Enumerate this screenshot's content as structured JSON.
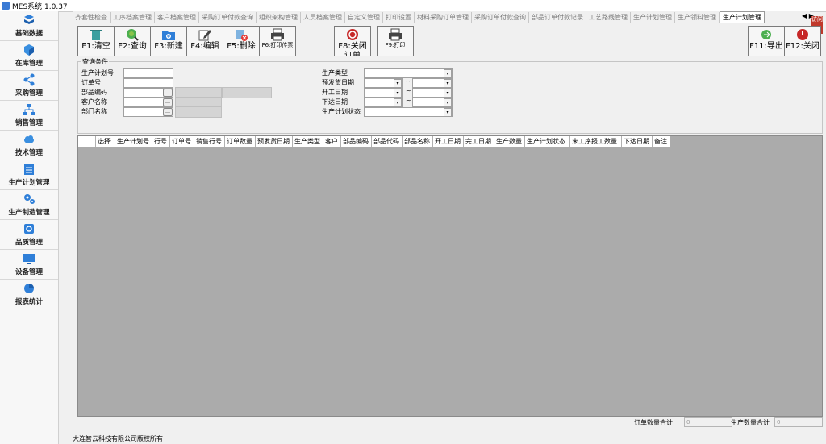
{
  "window": {
    "title": "MES系统 1.0.37"
  },
  "sidebar": {
    "items": [
      {
        "label": "基础数据",
        "icon": "cube-stack-icon"
      },
      {
        "label": "在库管理",
        "icon": "cube-icon"
      },
      {
        "label": "采购管理",
        "icon": "share-icon"
      },
      {
        "label": "销售管理",
        "icon": "org-chart-icon"
      },
      {
        "label": "技术管理",
        "icon": "cloud-icon"
      },
      {
        "label": "生产计划管理",
        "icon": "calendar-list-icon"
      },
      {
        "label": "生产制造管理",
        "icon": "gears-icon"
      },
      {
        "label": "品质管理",
        "icon": "quality-icon"
      },
      {
        "label": "设备管理",
        "icon": "monitor-icon"
      },
      {
        "label": "报表统计",
        "icon": "pie-chart-icon"
      }
    ]
  },
  "tabs": [
    "齐套性检查",
    "工序档案管理",
    "客户档案管理",
    "采购订单付款查询",
    "组织架构管理",
    "人员档案管理",
    "自定义管理",
    "打印设置",
    "材料采购订单管理",
    "采购订单付款查询",
    "部品订单付款记录",
    "工艺路线管理",
    "生产计划管理",
    "生产领料管理",
    "生产计划管理"
  ],
  "tab_nav": "◀ ▶",
  "badge": "访问",
  "toolbar": {
    "clear": "F1:清空",
    "query": "F2:查询",
    "new": "F3:新建",
    "edit": "F4:编辑",
    "delete": "F5:删除",
    "print_ticket": "F6:打印传票",
    "close_order": "F8:关闭订单",
    "print": "F9:打印",
    "export": "F11:导出",
    "close": "F12:关闭"
  },
  "query": {
    "legend": "查询条件",
    "plan_no": "生产计划号",
    "order_no": "订单号",
    "part_code": "部品编码",
    "customer": "客户名称",
    "dept": "部门名称",
    "prod_type": "生产类型",
    "ship_date": "预发货日期",
    "start_date": "开工日期",
    "issue_date": "下达日期",
    "plan_status": "生产计划状态",
    "tilde": "~"
  },
  "grid": {
    "columns": [
      "选择",
      "生产计划号",
      "行号",
      "订单号",
      "销售行号",
      "订单数量",
      "预发货日期",
      "生产类型",
      "客户",
      "部品编码",
      "部品代码",
      "部品名称",
      "开工日期",
      "完工日期",
      "生产数量",
      "生产计划状态",
      "末工序报工数量",
      "下达日期",
      "备注"
    ]
  },
  "summary": {
    "order_qty_label": "订单数量合计",
    "order_qty_value": "0",
    "prod_qty_label": "生产数量合计",
    "prod_qty_value": "0"
  },
  "status": {
    "copyright": "大连智云科技有限公司版权所有"
  }
}
